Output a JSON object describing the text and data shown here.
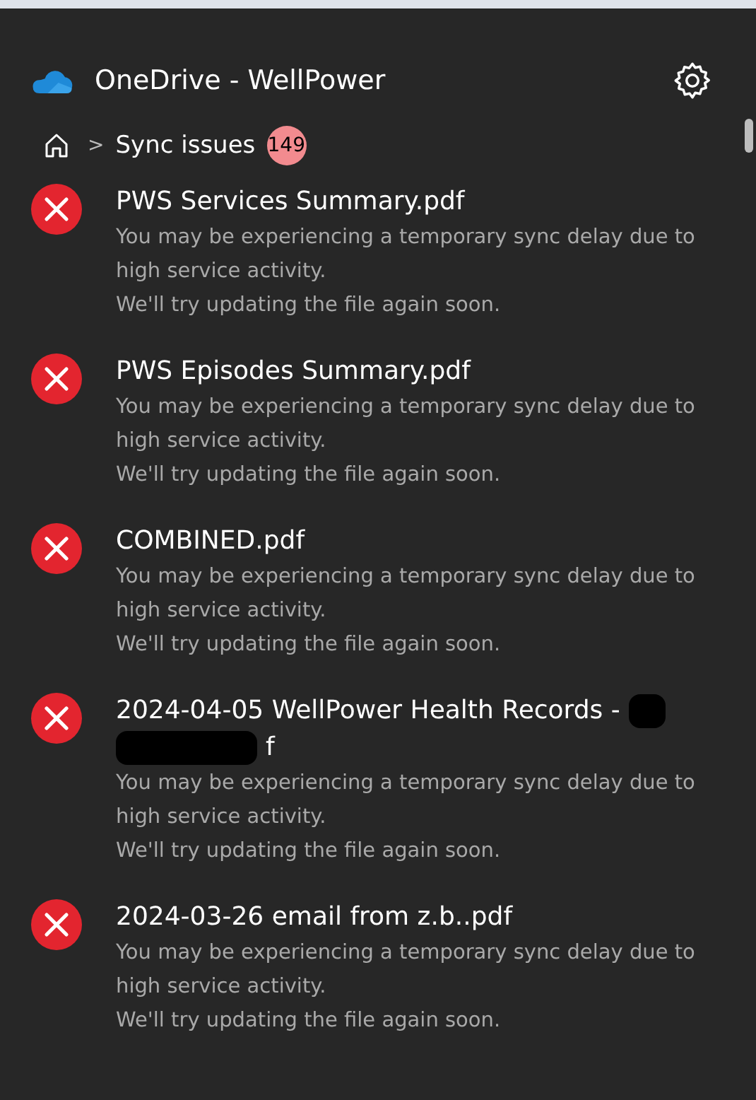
{
  "header": {
    "title": "OneDrive - WellPower"
  },
  "breadcrumb": {
    "separator": ">",
    "current": "Sync issues",
    "count": "149"
  },
  "issues": [
    {
      "title": "PWS Services Summary.pdf",
      "redacted": false,
      "message": "You may be experiencing a temporary sync delay due to high service activity.",
      "note": "We'll try updating the file again soon."
    },
    {
      "title": "PWS Episodes Summary.pdf",
      "redacted": false,
      "message": "You may be experiencing a temporary sync delay due to high service activity.",
      "note": "We'll try updating the file again soon."
    },
    {
      "title": "COMBINED.pdf",
      "redacted": false,
      "message": "You may be experiencing a temporary sync delay due to high service activity.",
      "note": "We'll try updating the file again soon."
    },
    {
      "title": "2024-04-05 WellPower Health Records -",
      "redacted": true,
      "title_end": "f",
      "message": "You may be experiencing a temporary sync delay due to high service activity.",
      "note": "We'll try updating the file again soon."
    },
    {
      "title": "2024-03-26 email from z.b..pdf",
      "redacted": false,
      "message": "You may be experiencing a temporary sync delay due to high service activity.",
      "note": "We'll try updating the file again soon."
    }
  ]
}
